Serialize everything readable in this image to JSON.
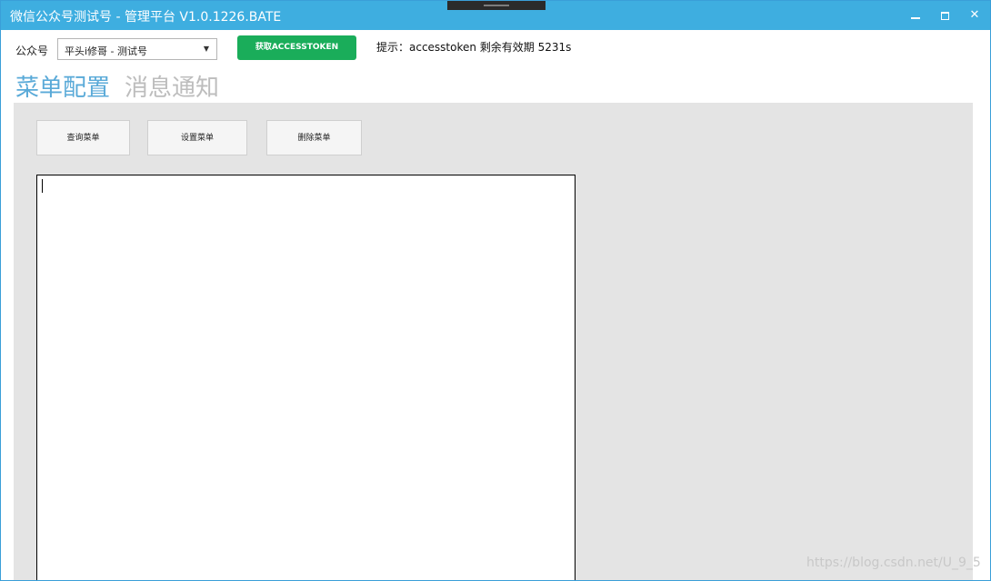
{
  "window": {
    "title": "微信公众号测试号 - 管理平台 V1.0.1226.BATE",
    "controls": {
      "minimize_icon": "minimize-icon",
      "maximize_icon": "maximize-icon",
      "close_icon": "close-icon",
      "close_glyph": "✕"
    }
  },
  "toolbar": {
    "account_label": "公众号",
    "account_selected": "平头i修哥 - 测试号",
    "dropdown_glyph": "▼",
    "get_token_label": "获取ACCESSTOKEN",
    "hint": "提示：accesstoken 剩余有效期 5231s"
  },
  "tabs": [
    {
      "label": "菜单配置",
      "active": true
    },
    {
      "label": "消息通知",
      "active": false
    }
  ],
  "menu_panel": {
    "query_label": "查询菜单",
    "set_label": "设置菜单",
    "delete_label": "删除菜单",
    "editor_value": ""
  },
  "watermark": "https://blog.csdn.net/U_9_5",
  "colors": {
    "titlebar": "#3eaee0",
    "token_button": "#1aad5a",
    "tab_active": "#5aaad8",
    "tab_inactive": "#bdbdbd",
    "panel_bg": "#e4e4e4"
  }
}
